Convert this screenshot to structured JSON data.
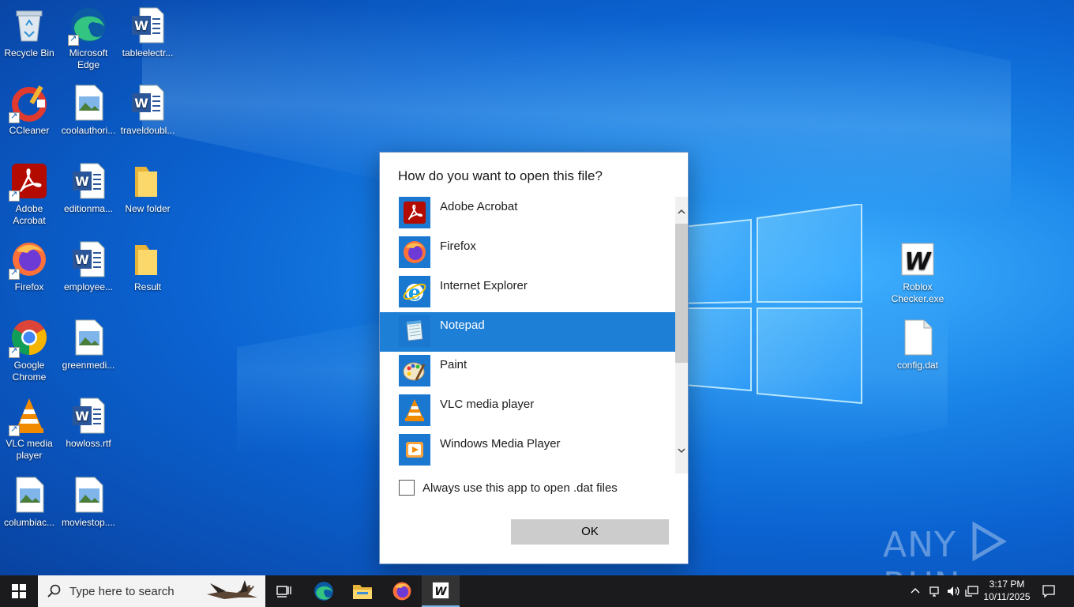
{
  "desktop": {
    "icons": [
      {
        "label": "Recycle Bin"
      },
      {
        "label": "Microsoft Edge"
      },
      {
        "label": "tableelectr..."
      },
      {
        "label": "CCleaner"
      },
      {
        "label": "coolauthori..."
      },
      {
        "label": "traveldoubl..."
      },
      {
        "label": "Adobe Acrobat"
      },
      {
        "label": "editionma..."
      },
      {
        "label": "New folder"
      },
      {
        "label": "Firefox"
      },
      {
        "label": "employee..."
      },
      {
        "label": "Result"
      },
      {
        "label": "Google Chrome"
      },
      {
        "label": "greenmedi..."
      },
      {
        "label": "VLC media player"
      },
      {
        "label": "howloss.rtf"
      },
      {
        "label": "columbiac..."
      },
      {
        "label": "moviestop...."
      },
      {
        "label": "Roblox Checker.exe"
      },
      {
        "label": "config.dat"
      }
    ]
  },
  "dialog": {
    "title": "How do you want to open this file?",
    "apps": [
      {
        "name": "Adobe Acrobat",
        "icon": "acrobat-icon",
        "selected": false
      },
      {
        "name": "Firefox",
        "icon": "firefox-icon",
        "selected": false
      },
      {
        "name": "Internet Explorer",
        "icon": "ie-icon",
        "selected": false
      },
      {
        "name": "Notepad",
        "icon": "notepad-icon",
        "selected": true
      },
      {
        "name": "Paint",
        "icon": "paint-icon",
        "selected": false
      },
      {
        "name": "VLC media player",
        "icon": "vlc-icon",
        "selected": false
      },
      {
        "name": "Windows Media Player",
        "icon": "wmp-icon",
        "selected": false
      }
    ],
    "always_label": "Always use this app to open .dat files",
    "always_checked": false,
    "ok_label": "OK"
  },
  "watermark": {
    "left": "ANY",
    "right": "RUN"
  },
  "taskbar": {
    "search_placeholder": "Type here to search",
    "time": "3:17 PM",
    "date": "10/11/2025"
  },
  "colors": {
    "selection": "#1e7fd6",
    "taskbar": "#1b1b1d",
    "desktop": "#0b63d1"
  }
}
